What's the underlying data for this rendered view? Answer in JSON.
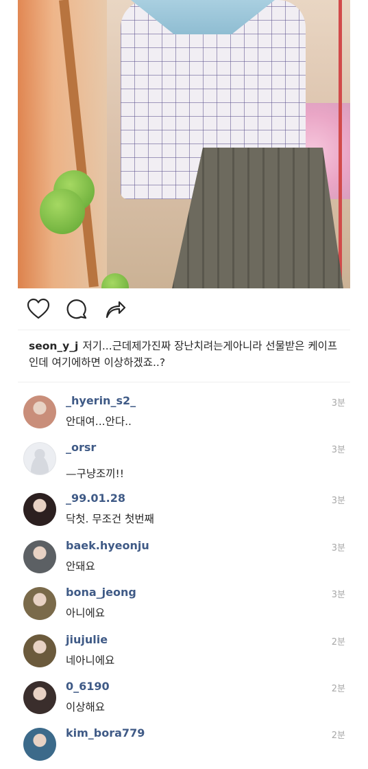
{
  "post": {
    "caption_user": "seon_y_j",
    "caption_text": "저기...근데제가진짜 장난치려는게아니라 선물받은 케이프인데 여기에하면 이상하겠죠..?"
  },
  "actions": [
    {
      "icon": "heart-icon"
    },
    {
      "icon": "comment-icon"
    },
    {
      "icon": "share-icon"
    }
  ],
  "comments": [
    {
      "username": "_hyerin_s2_",
      "text": "안대여...안다..",
      "time": "3분",
      "avatar_color": "#c98e7a"
    },
    {
      "username": "_orsr",
      "text": "—구냥조끼!!",
      "time": "3분",
      "avatar_color": "#eceef2"
    },
    {
      "username": "_99.01.28",
      "text": "닥첫. 무조건 첫번째",
      "time": "3분",
      "avatar_color": "#2c2020"
    },
    {
      "username": "baek.hyeonju",
      "text": "안돼요",
      "time": "3분",
      "avatar_color": "#5c6064"
    },
    {
      "username": "bona_jeong",
      "text": "아니에요",
      "time": "3분",
      "avatar_color": "#7a6a4a"
    },
    {
      "username": "jiujulie",
      "text": "네아니에요",
      "time": "2분",
      "avatar_color": "#6b5a3c"
    },
    {
      "username": "0_6190",
      "text": "이상해요",
      "time": "2분",
      "avatar_color": "#3a2e2c"
    },
    {
      "username": "kim_bora779",
      "text": "",
      "time": "2분",
      "avatar_color": "#3c6a8a"
    }
  ]
}
